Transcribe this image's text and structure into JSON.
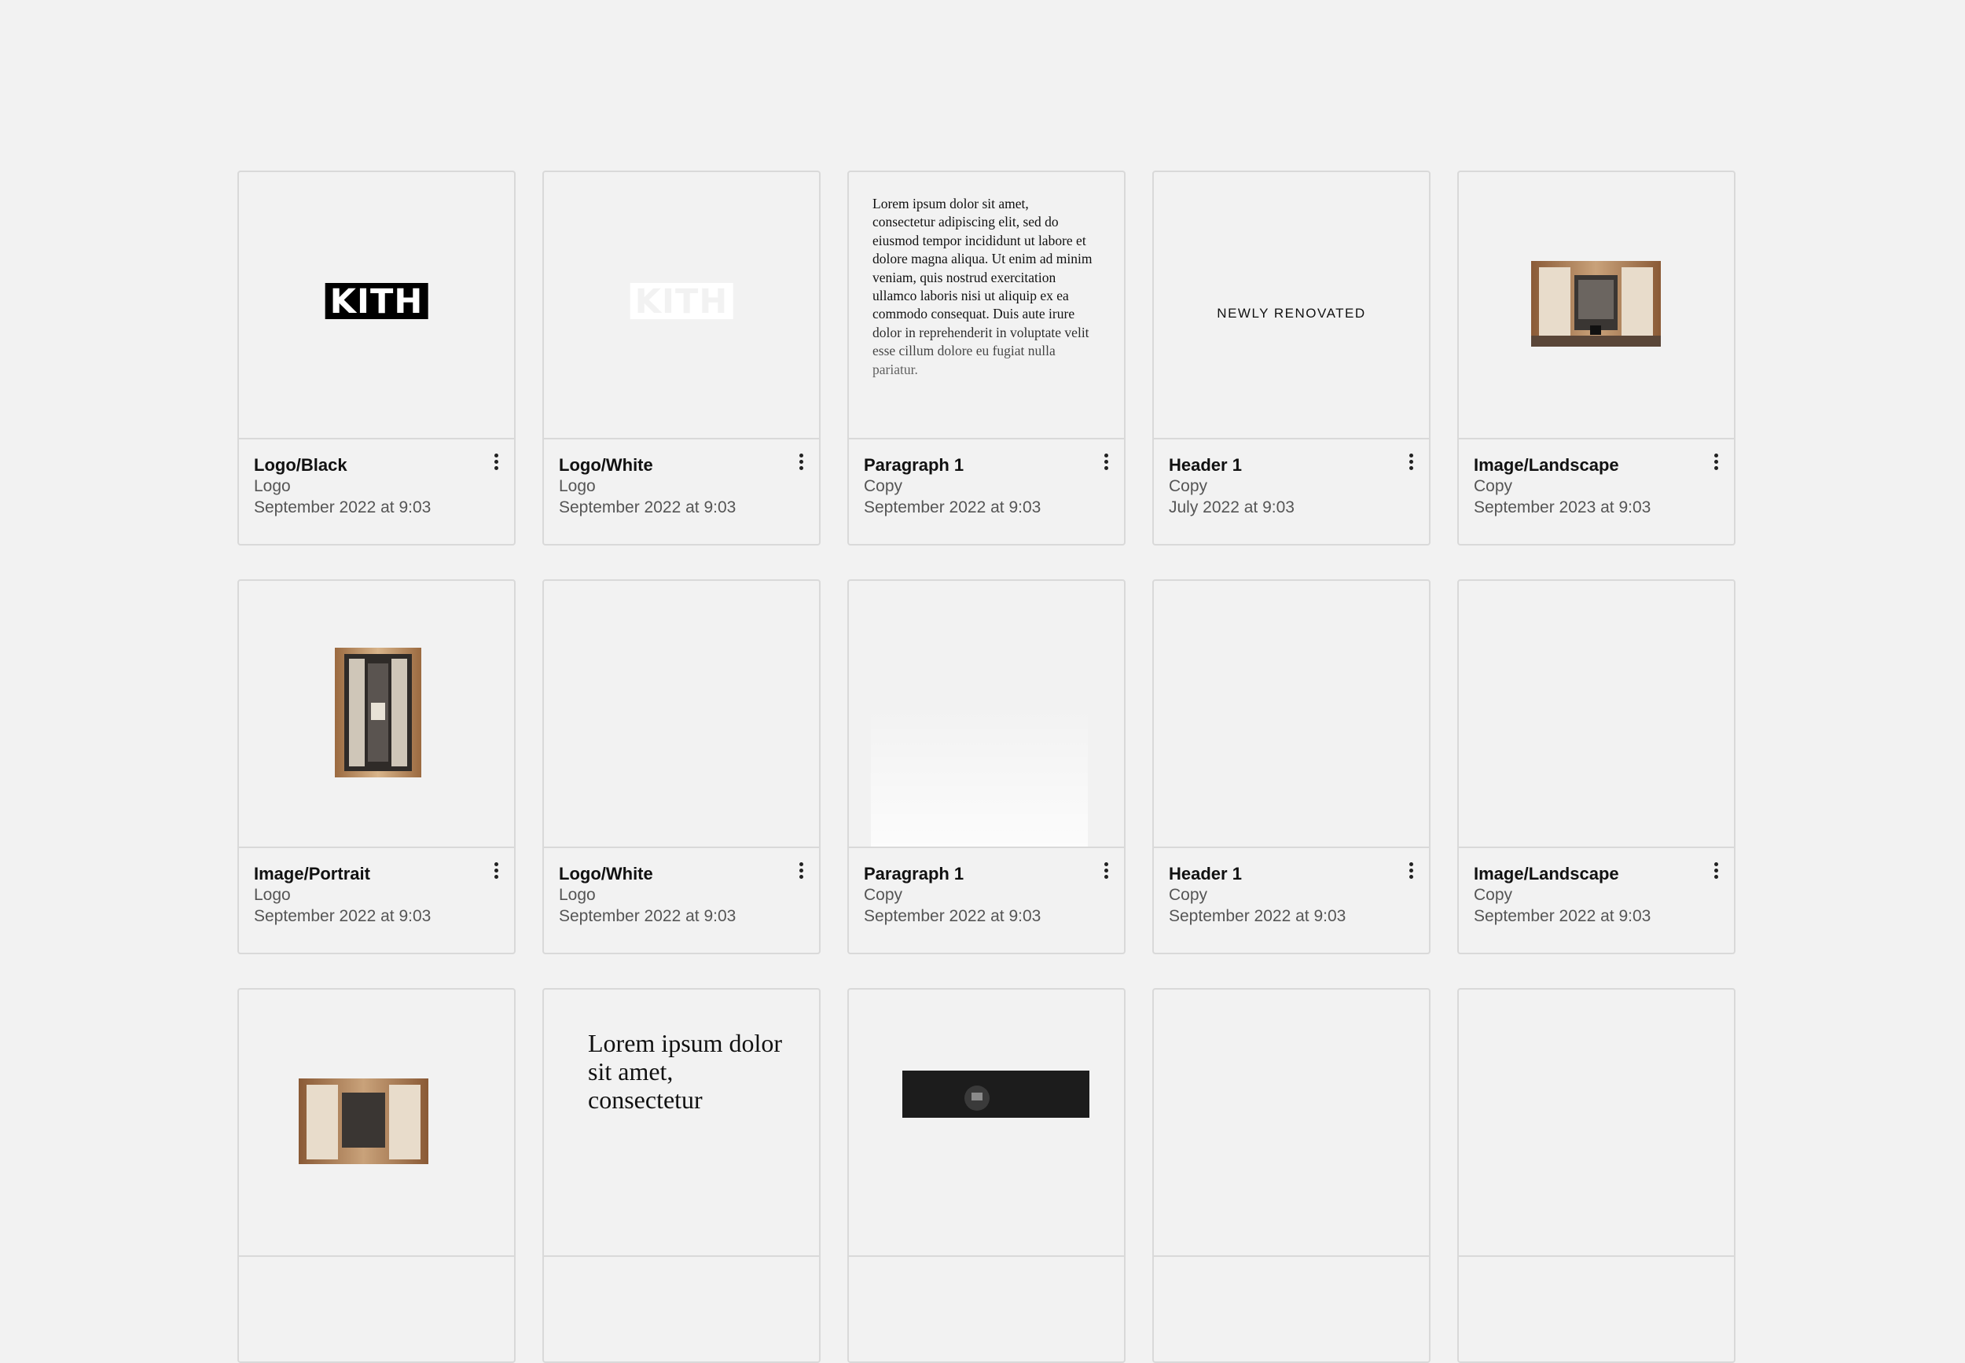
{
  "cards": [
    {
      "title": "Logo/Black",
      "type": "Logo",
      "date": "September 2022 at 9:03",
      "logo_text": "KITH"
    },
    {
      "title": "Logo/White",
      "type": "Logo",
      "date": "September 2022 at 9:03",
      "logo_text": "KITH"
    },
    {
      "title": "Paragraph 1",
      "type": "Copy",
      "date": "September 2022 at 9:03",
      "preview_text": "Lorem ipsum dolor sit amet, consectetur adipiscing elit, sed do eiusmod tempor incididunt ut labore et dolore magna aliqua. Ut enim ad minim veniam, quis nostrud exercitation ullamco laboris nisi ut aliquip ex ea commodo consequat. Duis aute irure dolor in reprehenderit in voluptate velit esse cillum dolore eu fugiat nulla pariatur."
    },
    {
      "title": "Header 1",
      "type": "Copy",
      "date": "July 2022 at 9:03",
      "preview_text": "NEWLY RENOVATED"
    },
    {
      "title": "Image/Landscape",
      "type": "Copy",
      "date": "September 2023 at 9:03"
    },
    {
      "title": "Image/Portrait",
      "type": "Logo",
      "date": "September 2022 at 9:03"
    },
    {
      "title": "Logo/White",
      "type": "Logo",
      "date": "September 2022 at 9:03"
    },
    {
      "title": "Paragraph 1",
      "type": "Copy",
      "date": "September 2022 at 9:03"
    },
    {
      "title": "Header 1",
      "type": "Copy",
      "date": "September 2022 at 9:03"
    },
    {
      "title": "Image/Landscape",
      "type": "Copy",
      "date": "September 2022 at 9:03"
    },
    {
      "title": "",
      "type": "",
      "date": ""
    },
    {
      "title": "",
      "type": "",
      "date": "",
      "preview_text": "Lorem ipsum dolor sit amet, consectetur"
    },
    {
      "title": "",
      "type": "",
      "date": ""
    },
    {
      "title": "",
      "type": "",
      "date": ""
    },
    {
      "title": "",
      "type": "",
      "date": ""
    }
  ],
  "icons": {
    "menu": "more-vertical-icon"
  },
  "colors": {
    "background": "#f2f2f2",
    "card_border": "#d9d9d9",
    "text_primary": "#111111",
    "text_secondary": "#555555"
  }
}
